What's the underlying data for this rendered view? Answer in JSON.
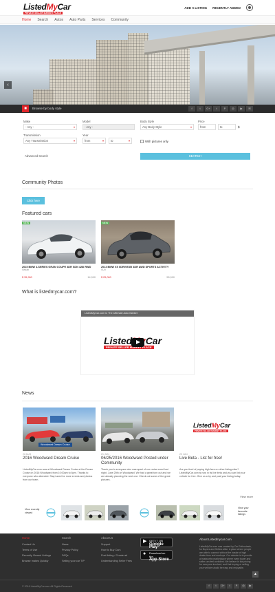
{
  "header": {
    "logo_main_a": "Listed",
    "logo_main_b": "My",
    "logo_main_c": "Car",
    "logo_sub": "PRIVATE SELLER MARKET PLACE",
    "add_listing": "ADD A LISTING",
    "recently_added": "RECENTLY ADDED"
  },
  "nav": {
    "items": [
      "Home",
      "Search",
      "Autos",
      "Auto Parts",
      "Services",
      "Community"
    ]
  },
  "hero": {
    "arrow": "‹"
  },
  "browse": {
    "label": "Browse by body style",
    "social": [
      "f",
      "t",
      "G+",
      "t",
      "P",
      "◎",
      "▶",
      "✉"
    ]
  },
  "search": {
    "make_label": "Make",
    "make_value": "- Any -",
    "model_label": "Model",
    "model_value": "- Any -",
    "body_label": "Body Style",
    "body_value": "Any Body Style",
    "price_label": "Price",
    "price_from": "from",
    "price_to": "to",
    "currency": "$",
    "trans_label": "Transmission",
    "trans_value": "Any Transmission",
    "year_label": "Year",
    "year_from": "from",
    "year_to": "to",
    "with_photos": "With pictures only",
    "advanced": "Advanced Search",
    "search_button": "SEARCH"
  },
  "community": {
    "title": "Community Photos",
    "button": "Click here"
  },
  "featured": {
    "title": "Featured cars",
    "cars": [
      {
        "badge": "NEW",
        "title": "2015 BMW 4-SERIES GRAN COUPE 4DR SDN 428I RWD",
        "type": "Sedan",
        "price": "$ 35,900",
        "miles": "14,000"
      },
      {
        "badge": "NEW",
        "title": "2013 BMW X5 XDRIVE35I 4DR AWD SPORTS ACTIVITY",
        "type": "SUV",
        "price": "$ 25,000",
        "miles": "55,000"
      }
    ]
  },
  "what_is": {
    "title": "What is listedmycar.com?",
    "video_title": "ListedMyCar.com is The Ultimate Auto Market"
  },
  "news": {
    "title": "News",
    "items": [
      {
        "date": "22 AUG",
        "title": "2016 Woodward Dream Cruise",
        "body": "ListedMyCar.com was at Woodward Dream Cruise at the Dream Cruise on 2016 Woodward from 10:00am to 6pm. Thanks to everyone who attended. Stay tuned for more events and photos from our team.",
        "caption": "Woodward Dream Cruise"
      },
      {
        "date": "21 JUN",
        "title": "06/25/2016 Woodward Posted under Community",
        "body": "Thank you to everyone who was apart of our cruise event last night. June 25th on Woodward. We had a great turn out and we are already planning the next one. Check out some of the great pictures."
      },
      {
        "date": "20 JUN",
        "title": "Live Beta - List for free!",
        "body": "Are you tired of paying high fees on other listing sites? ListedMyCar.com is now in its live beta and you can list your vehicle for free. Give us a try and post your listing today."
      }
    ],
    "view_more": "View more"
  },
  "strip": {
    "left_text": "View recently viewed",
    "right_text": "View your favourite listings"
  },
  "footer": {
    "col1_head": "Home",
    "col1": [
      "Contact Us",
      "Terms of Use",
      "Recently Viewed Listings",
      "Browse makes Quickly"
    ],
    "col2_head": "Search",
    "col2": [
      "News",
      "Privacy Policy",
      "FAQs",
      "Selling your car TIP"
    ],
    "col3_head": "About Us",
    "col3": [
      "Support",
      "How to Buy Cars",
      "Post listing / Create ad",
      "Understanding Seller Fees"
    ],
    "gplay_small": "GET IT ON",
    "gplay_big": "Google Play",
    "appstore_small": "Download on the",
    "appstore_big": "App Store",
    "about_title": "About Listedmycar.com",
    "about_text": "ListedMyCar.com was created by Car Enthusiasts, for Buyers and Sellers alike. A place where people are able to connect without the hassle of high dealer fees and markups. Our mission is to provide a trustworthy marketplace where every buyer and seller can feel confident. We believe in fair pricing for everyone involved, and that buying or selling your vehicle should be easy and enjoyable.",
    "copyright": "© 2016 ListedMyCar.com All Rights Reserved",
    "social": [
      "f",
      "t",
      "G+",
      "t",
      "P",
      "◎",
      "▶"
    ]
  }
}
